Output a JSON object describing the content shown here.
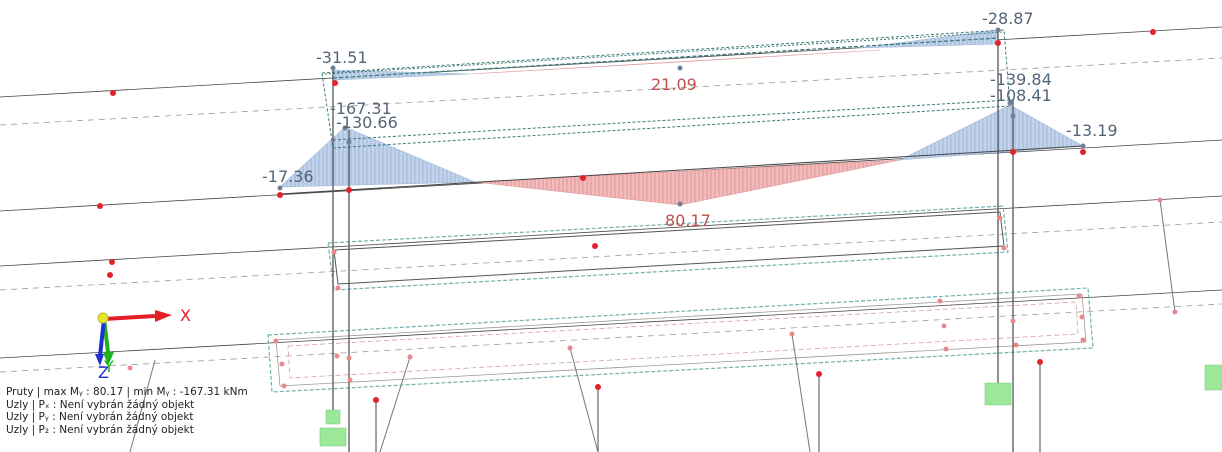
{
  "viewport": {
    "moment_labels": [
      {
        "id": "left-top-support",
        "text": "-31.51",
        "kind": "negative"
      },
      {
        "id": "right-top-support",
        "text": "-28.87",
        "kind": "negative"
      },
      {
        "id": "top-span",
        "text": "21.09",
        "kind": "positive"
      },
      {
        "id": "right-upper-1",
        "text": "-139.84",
        "kind": "negative"
      },
      {
        "id": "right-upper-2",
        "text": "-108.41",
        "kind": "negative"
      },
      {
        "id": "left-upper-1",
        "text": "-167.31",
        "kind": "negative"
      },
      {
        "id": "left-upper-2",
        "text": "-130.66",
        "kind": "negative"
      },
      {
        "id": "right-cantilever",
        "text": "-13.19",
        "kind": "negative"
      },
      {
        "id": "left-cantilever",
        "text": "-17.36",
        "kind": "negative"
      },
      {
        "id": "main-span",
        "text": "80.17",
        "kind": "positive"
      }
    ],
    "axes": {
      "x_label": "X",
      "z_label": "Z",
      "y_label": "Y"
    }
  },
  "status_panel": {
    "line1": "Pruty | max Mᵧ : 80.17 | min Mᵧ : -167.31 kNm",
    "line2": "Uzly | Pₓ : Není vybrán žádný objekt",
    "line3": "Uzly | Pᵧ : Není vybrán žádný objekt",
    "line4": "Uzly | P₂ : Není vybrán žádný objekt"
  },
  "colors": {
    "negative_fill": "#b9cce6",
    "positive_fill": "#f0b3b3",
    "node": "#e0242b",
    "support": "#9be89b",
    "axis_x": "#e41e26",
    "axis_y": "#1fb31f",
    "axis_z": "#1f2fd6"
  }
}
